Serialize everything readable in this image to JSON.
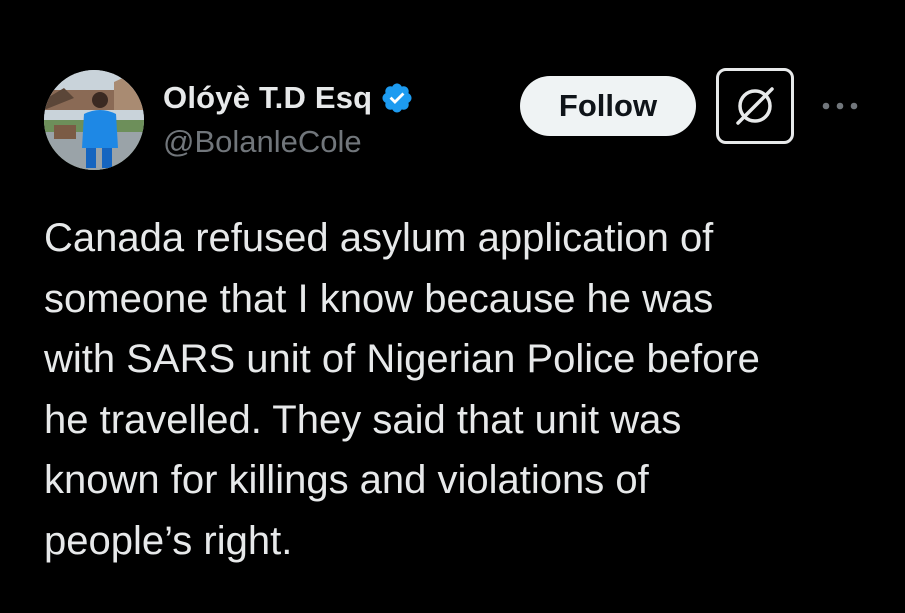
{
  "author": {
    "display_name": "Olóyè T.D Esq",
    "handle": "@BolanleCole",
    "verified": true,
    "verified_icon": "verified-badge-icon",
    "avatar_icon": "profile-photo"
  },
  "actions": {
    "follow_label": "Follow",
    "grok_icon": "grok-icon",
    "more_icon": "more-options-icon"
  },
  "tweet": {
    "text": "Canada refused asylum application of\nsomeone that I know because he was\nwith SARS unit of Nigerian Police before\nhe travelled. They said that unit was\nknown for killings and violations of\npeople’s right."
  },
  "colors": {
    "background": "#000000",
    "text_primary": "#e7e9ea",
    "text_secondary": "#71767b",
    "verified_blue": "#1d9bf0",
    "follow_bg": "#eff3f4",
    "follow_text": "#0f1419"
  }
}
